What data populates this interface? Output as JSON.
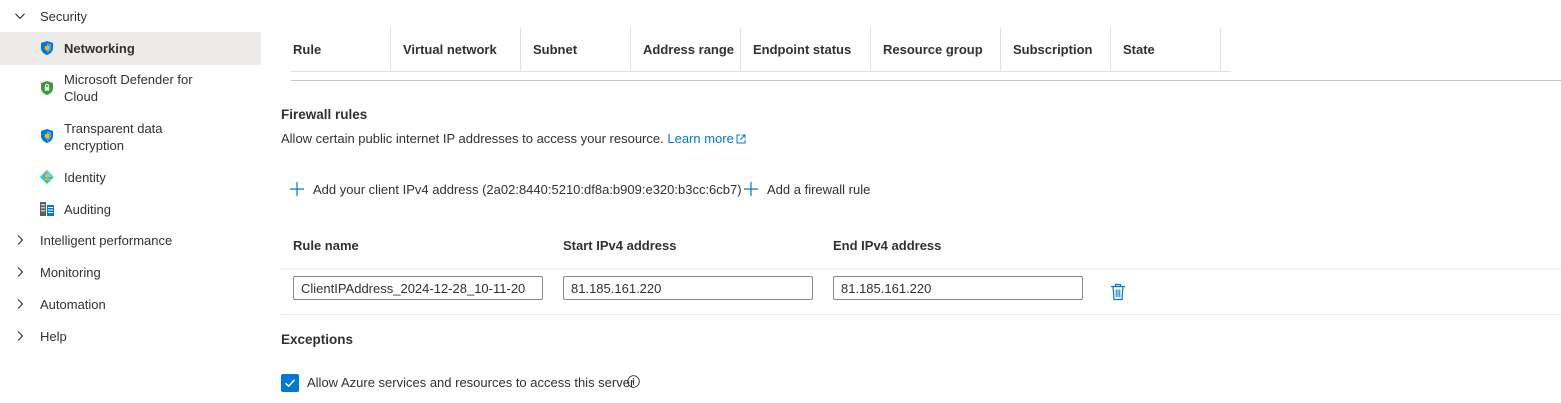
{
  "sidebar": {
    "security": "Security",
    "items": [
      {
        "label": "Networking",
        "icon": "shield-icon"
      },
      {
        "label": "Microsoft Defender for Cloud",
        "icon": "defender-shield-icon"
      },
      {
        "label": "Transparent data encryption",
        "icon": "shield-icon"
      },
      {
        "label": "Identity",
        "icon": "identity-icon"
      },
      {
        "label": "Auditing",
        "icon": "auditing-icon"
      }
    ],
    "groups": [
      "Intelligent performance",
      "Monitoring",
      "Automation",
      "Help"
    ]
  },
  "vnet_table": {
    "columns": [
      "Rule",
      "Virtual network",
      "Subnet",
      "Address range",
      "Endpoint status",
      "Resource group",
      "Subscription",
      "State"
    ]
  },
  "firewall": {
    "title": "Firewall rules",
    "description": "Allow certain public internet IP addresses to access your resource.",
    "learn_more": "Learn more",
    "add_client_ip": "Add your client IPv4 address (2a02:8440:5210:df8a:b909:e320:b3cc:6cb7)",
    "add_rule": "Add a firewall rule",
    "columns": {
      "rule_name": "Rule name",
      "start_ip": "Start IPv4 address",
      "end_ip": "End IPv4 address"
    },
    "rule": {
      "name": "ClientIPAddress_2024-12-28_10-11-20",
      "start_ip": "81.185.161.220",
      "end_ip": "81.185.161.220"
    }
  },
  "exceptions": {
    "title": "Exceptions",
    "allow_azure_label": "Allow Azure services and resources to access this server",
    "allow_azure_checked": true
  },
  "colors": {
    "accent": "#0078d4",
    "selected_bg": "#edebe9"
  }
}
